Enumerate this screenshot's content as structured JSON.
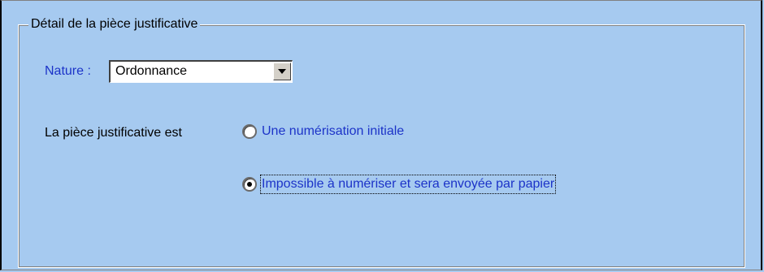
{
  "groupbox": {
    "title": "Détail de la pièce justificative"
  },
  "nature": {
    "label": "Nature :",
    "selected": "Ordonnance"
  },
  "piece": {
    "lead_text": "La pièce justificative est",
    "options": [
      {
        "label": "Une numérisation initiale",
        "checked": false
      },
      {
        "label": "Impossible à numériser et sera envoyée par papier",
        "checked": true
      }
    ]
  },
  "colors": {
    "background": "#a6caf0",
    "label_blue": "#1c33c8"
  }
}
